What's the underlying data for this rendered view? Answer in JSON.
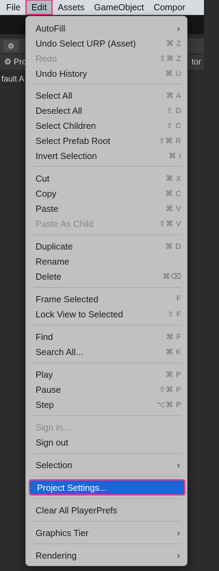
{
  "menubar": {
    "items": [
      {
        "label": "File"
      },
      {
        "label": "Edit"
      },
      {
        "label": "Assets"
      },
      {
        "label": "GameObject"
      },
      {
        "label": "Compor"
      }
    ]
  },
  "background": {
    "tab_icon": "⚙",
    "panel_tab": "Pro",
    "panel_tab_right": "tor",
    "panel_line2": "fault A"
  },
  "menu": {
    "items": [
      {
        "label": "AutoFill",
        "shortcut": "",
        "submenu": true
      },
      {
        "label": "Undo Select URP (Asset)",
        "shortcut": "⌘ Z"
      },
      {
        "label": "Redo",
        "shortcut": "⇧⌘ Z",
        "disabled": true
      },
      {
        "label": "Undo History",
        "shortcut": "⌘ U"
      },
      {
        "label": "Select All",
        "shortcut": "⌘ A"
      },
      {
        "label": "Deselect All",
        "shortcut": "⇧ D"
      },
      {
        "label": "Select Children",
        "shortcut": "⇧ C"
      },
      {
        "label": "Select Prefab Root",
        "shortcut": "⇧⌘ R"
      },
      {
        "label": "Invert Selection",
        "shortcut": "⌘ I"
      },
      {
        "label": "Cut",
        "shortcut": "⌘ X"
      },
      {
        "label": "Copy",
        "shortcut": "⌘ C"
      },
      {
        "label": "Paste",
        "shortcut": "⌘ V"
      },
      {
        "label": "Paste As Child",
        "shortcut": "⇧⌘ V",
        "disabled": true
      },
      {
        "label": "Duplicate",
        "shortcut": "⌘ D"
      },
      {
        "label": "Rename",
        "shortcut": ""
      },
      {
        "label": "Delete",
        "shortcut": "⌘⌫"
      },
      {
        "label": "Frame Selected",
        "shortcut": "F"
      },
      {
        "label": "Lock View to Selected",
        "shortcut": "⇧ F"
      },
      {
        "label": "Find",
        "shortcut": "⌘ F"
      },
      {
        "label": "Search All...",
        "shortcut": "⌘ K"
      },
      {
        "label": "Play",
        "shortcut": "⌘ P"
      },
      {
        "label": "Pause",
        "shortcut": "⇧⌘ P"
      },
      {
        "label": "Step",
        "shortcut": "⌥⌘ P"
      },
      {
        "label": "Sign in...",
        "shortcut": "",
        "disabled": true
      },
      {
        "label": "Sign out",
        "shortcut": ""
      },
      {
        "label": "Selection",
        "shortcut": "",
        "submenu": true
      },
      {
        "label": "Project Settings...",
        "shortcut": "",
        "selected": true
      },
      {
        "label": "Clear All PlayerPrefs",
        "shortcut": ""
      },
      {
        "label": "Graphics Tier",
        "shortcut": "",
        "submenu": true
      },
      {
        "label": "Rendering",
        "shortcut": "",
        "submenu": true
      }
    ],
    "chevron": "›"
  },
  "colors": {
    "highlight": "#1f63d6",
    "focus_outline": "#e8447f",
    "menu_bg": "#c1c1c1"
  }
}
